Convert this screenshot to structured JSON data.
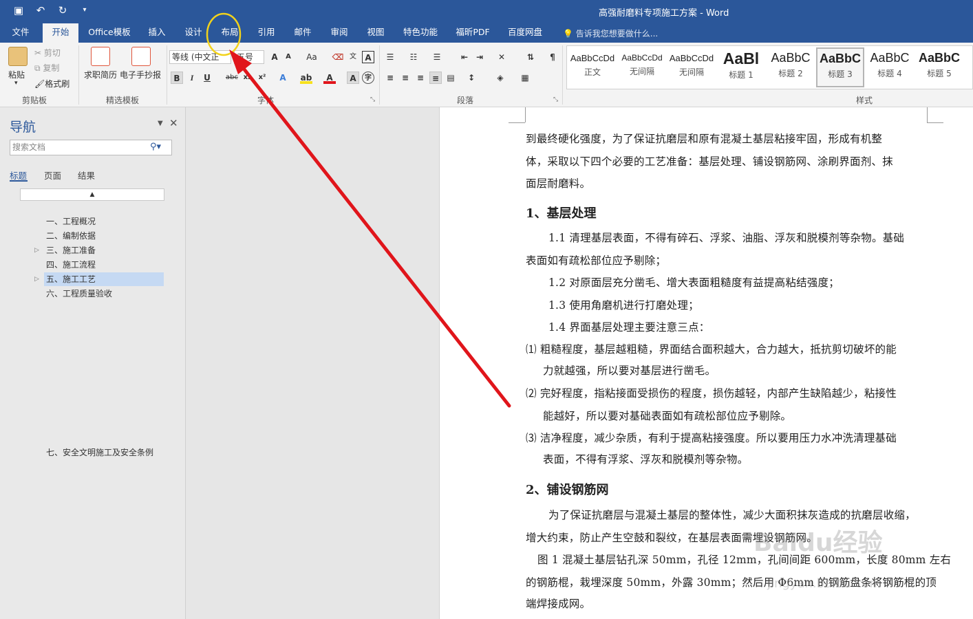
{
  "window": {
    "title": "高强耐磨料专项施工方案 - Word"
  },
  "qat": {
    "save_icon": "save-icon",
    "undo_icon": "undo-icon",
    "redo_icon": "redo-icon",
    "customize_icon": "customize-qat-icon"
  },
  "tabs": [
    {
      "label": "文件"
    },
    {
      "label": "开始"
    },
    {
      "label": "Office模板"
    },
    {
      "label": "插入"
    },
    {
      "label": "设计"
    },
    {
      "label": "布局"
    },
    {
      "label": "引用"
    },
    {
      "label": "邮件"
    },
    {
      "label": "审阅"
    },
    {
      "label": "视图"
    },
    {
      "label": "特色功能"
    },
    {
      "label": "福昕PDF"
    },
    {
      "label": "百度网盘"
    }
  ],
  "tell_me": "告诉我您想要做什么...",
  "ribbon": {
    "clipboard": {
      "paste": "粘贴",
      "cut": "剪切",
      "copy": "复制",
      "format_painter": "格式刷",
      "group": "剪贴板"
    },
    "templates": {
      "resume": "求职简历",
      "handwritten": "电子手抄报",
      "group": "精选模板"
    },
    "font": {
      "font_name": "等线 (中文正",
      "font_size": "五号",
      "group": "字体",
      "bold": "B",
      "italic": "I",
      "underline": "U",
      "strike": "abc",
      "subscript": "x₂",
      "superscript": "x²",
      "aa": "Aa",
      "grow": "A",
      "shrink": "A"
    },
    "paragraph": {
      "group": "段落"
    },
    "styles": {
      "group": "样式",
      "items": [
        {
          "sample": "AaBbCcDd",
          "name": "正文"
        },
        {
          "sample": "AaBbCcDd",
          "name": "无间隔"
        },
        {
          "sample": "AaBbCcDd",
          "name": "无间隔"
        },
        {
          "sample": "AaBl",
          "name": "标题 1"
        },
        {
          "sample": "AaBbC",
          "name": "标题 2"
        },
        {
          "sample": "AaBbC",
          "name": "标题 3"
        },
        {
          "sample": "AaBbC",
          "name": "标题 4"
        },
        {
          "sample": "AaBbC",
          "name": "标题 5"
        }
      ]
    }
  },
  "nav": {
    "title": "导航",
    "search_placeholder": "搜索文档",
    "tabs": [
      "标题",
      "页面",
      "结果"
    ],
    "headings": [
      "一、工程概况",
      "二、编制依据",
      "三、施工准备",
      "四、施工流程",
      "五、施工工艺",
      "六、工程质量验收",
      "七、安全文明施工及安全条例"
    ]
  },
  "doc": {
    "lines": [
      "到最终硬化强度，为了保证抗磨层和原有混凝土基层粘接牢固，形成有机整",
      "体，采取以下四个必要的工艺准备：基层处理、铺设钢筋网、涂刷界面剂、抹",
      "面层耐磨料。",
      "1.1 清理基层表面，不得有碎石、浮浆、油脂、浮灰和脱模剂等杂物。基础",
      "表面如有疏松部位应予剔除；",
      "1.2 对原面层充分凿毛、增大表面粗糙度有益提高粘结强度；",
      "1.3 使用角磨机进行打磨处理；",
      "1.4 界面基层处理主要注意三点：",
      "⑴ 粗糙程度，基层越粗糙，界面结合面积越大，合力越大，抵抗剪切破坏的能",
      "力就越强，所以要对基层进行凿毛。",
      "⑵ 完好程度，指粘接面受损伤的程度，损伤越轻，内部产生缺陷越少，粘接性",
      "能越好，所以要对基础表面如有疏松部位应予剔除。",
      "⑶ 洁净程度，减少杂质，有利于提高粘接强度。所以要用压力水冲洗清理基础",
      "表面，不得有浮浆、浮灰和脱模剂等杂物。",
      "为了保证抗磨层与混凝土基层的整体性，减少大面积抹灰造成的抗磨层收缩，",
      "增大约束，防止产生空鼓和裂纹，在基层表面需埋设钢筋网。",
      "图 1   混凝土基层钻孔深 50mm，孔径 12mm，孔间间距 600mm，长度 80mm 左右",
      "的钢筋棍，栽埋深度 50mm，外露 30mm；然后用 Φ6mm 的钢筋盘条将钢筋棍的顶",
      "端焊接成网。"
    ],
    "heading1": "1、基层处理",
    "heading2": "2、铺设钢筋网"
  },
  "watermark": {
    "text": "Baidu经验",
    "sub": "jingyan.baidu.com"
  },
  "colors": {
    "brand": "#2b579a",
    "arrow": "#e0151b",
    "circle": "#f2d21b"
  }
}
